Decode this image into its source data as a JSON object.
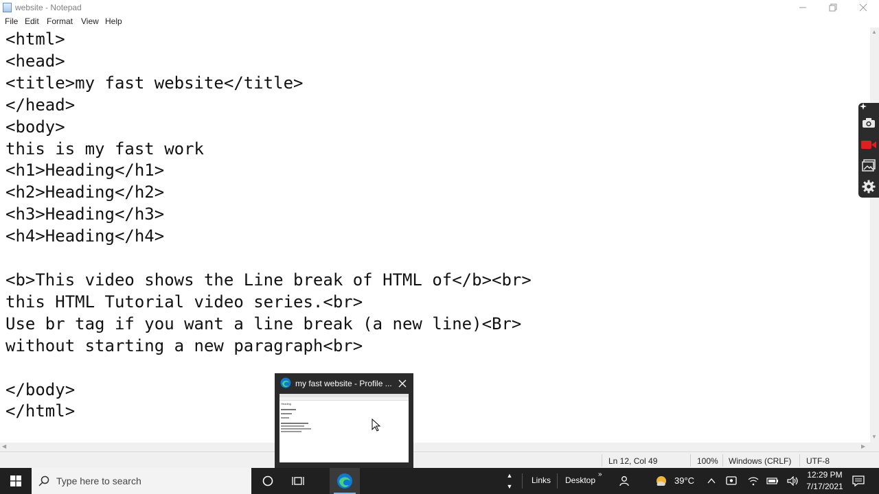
{
  "window": {
    "title": "website - Notepad"
  },
  "menu": [
    "File",
    "Edit",
    "Format",
    "View",
    "Help"
  ],
  "editor": {
    "lines": [
      "<html>",
      "<head>",
      "<title>my fast website</title>",
      "</head>",
      "<body>",
      "this is my fast work",
      "<h1>Heading</h1>",
      "<h2>Heading</h2>",
      "<h3>Heading</h3>",
      "<h4>Heading</h4>",
      "",
      "<b>This video shows the Line break of HTML of</b><br>",
      "this HTML Tutorial video series.<br>",
      "Use br tag if you want a line break (a new line)<Br>",
      "without starting a new paragraph<br>",
      "",
      "</body>",
      "</html>"
    ]
  },
  "status": {
    "position": "Ln 12, Col 49",
    "zoom": "100%",
    "line_ending": "Windows (CRLF)",
    "encoding": "UTF-8"
  },
  "side_tools": [
    "camera-icon",
    "record-icon",
    "gallery-icon",
    "settings-icon"
  ],
  "preview": {
    "title": "my fast website - Profile ...",
    "thumb_heading": "Heading"
  },
  "taskbar": {
    "search_placeholder": "Type here to search",
    "links_label": "Links",
    "desktop_label": "Desktop",
    "weather": "39°C",
    "time": "12:29 PM",
    "date": "7/17/2021"
  },
  "colors": {
    "taskbar": "#202020",
    "edge_blue": "#0c7bd4",
    "record_red": "#e02020"
  }
}
